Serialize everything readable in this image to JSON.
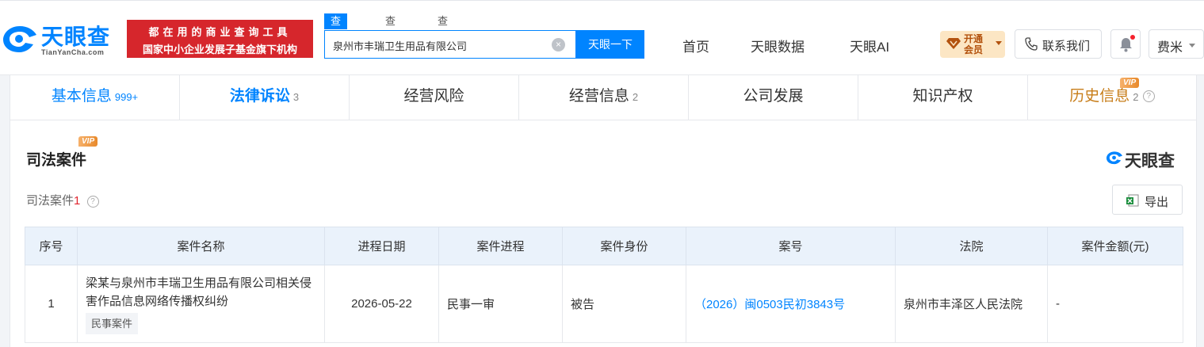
{
  "header": {
    "logo_text": "天眼查",
    "logo_sub": "TianYanCha.com",
    "slogan_line1": "都在用的商业查询工具",
    "slogan_line2": "国家中小企业发展子基金旗下机构",
    "search_tabs": [
      "查公司",
      "查老板",
      "查关系"
    ],
    "search_value": "泉州市丰瑞卫生用品有限公司",
    "search_button": "天眼一下",
    "nav": [
      "首页",
      "天眼数据",
      "天眼AI"
    ],
    "vip_open_line1": "开通",
    "vip_open_line2": "会员",
    "contact": "联系我们",
    "user_name": "费米"
  },
  "section_tabs": [
    {
      "label": "基本信息",
      "count": "999+"
    },
    {
      "label": "法律诉讼",
      "count": "3"
    },
    {
      "label": "经营风险",
      "count": ""
    },
    {
      "label": "经营信息",
      "count": "2"
    },
    {
      "label": "公司发展",
      "count": ""
    },
    {
      "label": "知识产权",
      "count": ""
    },
    {
      "label": "历史信息",
      "count": "2"
    }
  ],
  "vip_tag": "VIP",
  "section": {
    "title": "司法案件",
    "brand": "天眼查",
    "sub_title": "司法案件",
    "sub_count": "1",
    "export": "导出"
  },
  "table": {
    "headers": [
      "序号",
      "案件名称",
      "进程日期",
      "案件进程",
      "案件身份",
      "案号",
      "法院",
      "案件金额(元)"
    ],
    "rows": [
      {
        "index": "1",
        "name": "梁某与泉州市丰瑞卫生用品有限公司相关侵害作品信息网络传播权纠纷",
        "tag": "民事案件",
        "date": "2026-05-22",
        "stage": "民事一审",
        "role": "被告",
        "case_no": "（2026）闽0503民初3843号",
        "court": "泉州市丰泽区人民法院",
        "amount": "-"
      }
    ]
  },
  "colors": {
    "brand_blue": "#0084ff",
    "slogan_red": "#d6262c",
    "count_red": "#e0252e",
    "vip_orange": "#c77d19"
  }
}
